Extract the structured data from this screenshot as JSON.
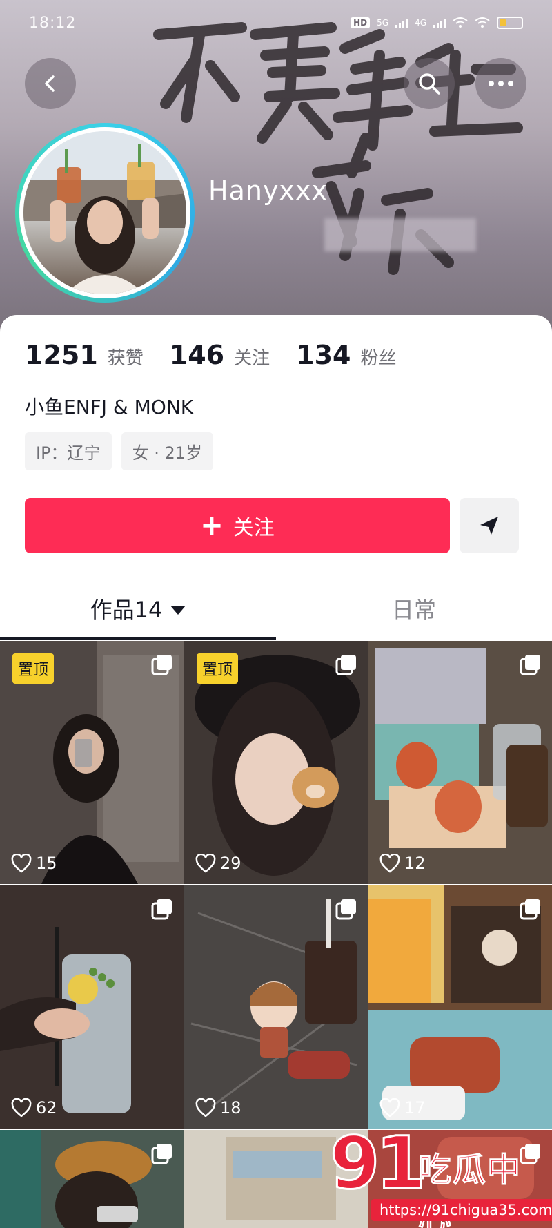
{
  "status_bar": {
    "time": "18:12",
    "hd_label": "HD",
    "net_1": "5G",
    "net_2": "4G"
  },
  "header": {
    "back_icon": "chevron-left-icon",
    "search_icon": "search-icon",
    "more_icon": "more-horizontal-icon",
    "username": "Hanyxxx",
    "background_text": "不要靠近"
  },
  "stats": [
    {
      "value": "1251",
      "label": "获赞"
    },
    {
      "value": "146",
      "label": "关注"
    },
    {
      "value": "134",
      "label": "粉丝"
    }
  ],
  "bio": "小鱼ENFJ & MONK",
  "tags": [
    "IP：辽宁",
    "女 · 21岁"
  ],
  "follow_button": {
    "label": "关注",
    "icon": "plus-icon"
  },
  "message_button": {
    "icon": "send-icon"
  },
  "tabs": {
    "works": "作品14",
    "daily": "日常"
  },
  "pin_label": "置顶",
  "grid": [
    {
      "likes": "15",
      "pinned": true,
      "bg": "#5f5652"
    },
    {
      "likes": "29",
      "pinned": true,
      "bg": "#3e3532"
    },
    {
      "likes": "12",
      "pinned": false,
      "bg": "#8d7d6d"
    },
    {
      "likes": "62",
      "pinned": false,
      "bg": "#3a3230"
    },
    {
      "likes": "18",
      "pinned": false,
      "bg": "#4b4745"
    },
    {
      "likes": "17",
      "pinned": false,
      "bg": "#c59a4a"
    },
    {
      "likes": "",
      "pinned": false,
      "bg": "#7d5e3c"
    },
    {
      "likes": "",
      "pinned": false,
      "bg": "#c8c0b2"
    },
    {
      "likes": "",
      "pinned": false,
      "bg": "#9a3a36"
    }
  ],
  "watermark": {
    "number": "91",
    "name": "吃瓜中心",
    "url": "https://91chigua35.com"
  },
  "colors": {
    "accent": "#fe2c55",
    "pin_badge": "#f7d12c",
    "watermark": "#e8233b"
  }
}
